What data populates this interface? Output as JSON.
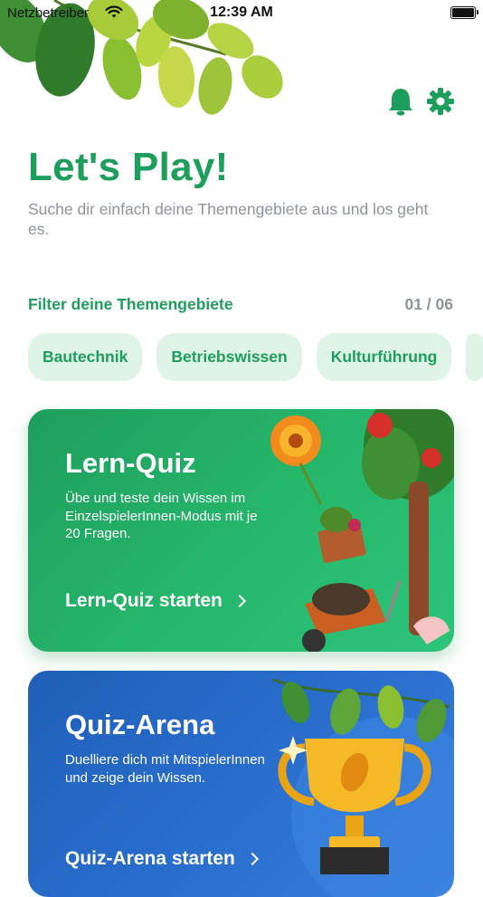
{
  "status_bar": {
    "carrier": "Netzbetreiber",
    "time": "12:39 AM"
  },
  "header": {
    "notification_icon": "bell-icon",
    "settings_icon": "gear-icon"
  },
  "page": {
    "title": "Let's Play!",
    "subtitle": "Suche dir einfach deine Themengebiete aus und los geht es."
  },
  "filter": {
    "label": "Filter deine Themengebiete",
    "count": "01 / 06",
    "chips": [
      "Bautechnik",
      "Betriebswissen",
      "Kulturführung"
    ]
  },
  "cards": {
    "quiz": {
      "title": "Lern-Quiz",
      "description": "Übe und teste dein Wissen im EinzelspielerInnen-Modus mit je 20 Fragen.",
      "cta": "Lern-Quiz starten"
    },
    "arena": {
      "title": "Quiz-Arena",
      "description": "Duelliere dich mit MitspielerInnen und zeige dein Wissen.",
      "cta": "Quiz-Arena starten"
    }
  },
  "colors": {
    "brand_green": "#1e9e5c",
    "chip_bg": "#dff4e6",
    "muted_text": "#8f9499",
    "arena_blue": "#2a6fce"
  }
}
